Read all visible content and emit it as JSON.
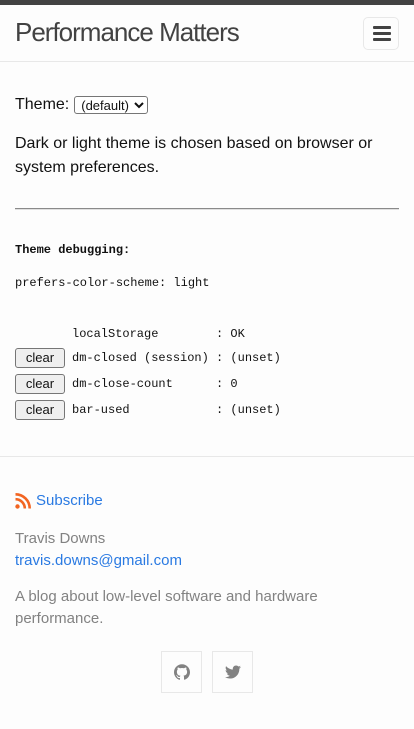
{
  "header": {
    "site_title": "Performance Matters",
    "menu_icon": "hamburger-icon"
  },
  "theme": {
    "label": "Theme:",
    "selected": "(default)",
    "description": "Dark or light theme is chosen based on browser or system preferences."
  },
  "debug": {
    "title": "Theme debugging:",
    "prefers_color_scheme": "prefers-color-scheme: light",
    "local_storage": "localStorage        : OK",
    "rows": [
      {
        "button": "clear",
        "text": "dm-closed (session) : (unset)"
      },
      {
        "button": "clear",
        "text": "dm-close-count      : 0"
      },
      {
        "button": "clear",
        "text": "bar-used            : (unset)"
      }
    ]
  },
  "footer": {
    "subscribe_label": "Subscribe",
    "author": "Travis Downs",
    "email": "travis.downs@gmail.com",
    "tagline": "A blog about low-level software and hardware performance.",
    "social": [
      {
        "icon": "github-icon"
      },
      {
        "icon": "twitter-icon"
      }
    ]
  },
  "colors": {
    "topbar": "#424242",
    "link": "#2a7ae2",
    "rss": "#f26522",
    "muted": "#828282"
  }
}
